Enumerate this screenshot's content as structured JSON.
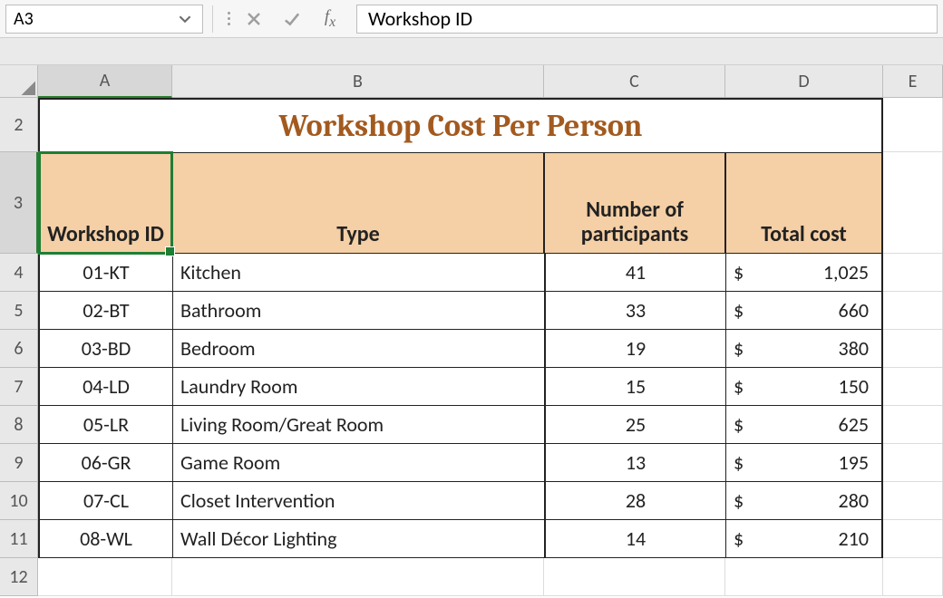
{
  "formulaBar": {
    "nameBox": "A3",
    "formula": "Workshop ID"
  },
  "columns": [
    "A",
    "B",
    "C",
    "D",
    "E"
  ],
  "activeColumn": "A",
  "activeRow": 3,
  "titleRow": 2,
  "title": "Workshop Cost Per Person",
  "headers": {
    "id": "Workshop ID",
    "type": "Type",
    "participants": "Number of participants",
    "cost": "Total cost"
  },
  "currencySymbol": "$",
  "rows": [
    {
      "n": 4,
      "id": "01-KT",
      "type": "Kitchen",
      "participants": 41,
      "cost": "1,025"
    },
    {
      "n": 5,
      "id": "02-BT",
      "type": "Bathroom",
      "participants": 33,
      "cost": "660"
    },
    {
      "n": 6,
      "id": "03-BD",
      "type": "Bedroom",
      "participants": 19,
      "cost": "380"
    },
    {
      "n": 7,
      "id": "04-LD",
      "type": "Laundry Room",
      "participants": 15,
      "cost": "150"
    },
    {
      "n": 8,
      "id": "05-LR",
      "type": "Living Room/Great Room",
      "participants": 25,
      "cost": "625"
    },
    {
      "n": 9,
      "id": "06-GR",
      "type": "Game Room",
      "participants": 13,
      "cost": "195"
    },
    {
      "n": 10,
      "id": "07-CL",
      "type": "Closet Intervention",
      "participants": 28,
      "cost": "280"
    },
    {
      "n": 11,
      "id": "08-WL",
      "type": "Wall Décor Lighting",
      "participants": 14,
      "cost": "210"
    }
  ],
  "emptyRow": 12,
  "chart_data": {
    "type": "table",
    "title": "Workshop Cost Per Person",
    "columns": [
      "Workshop ID",
      "Type",
      "Number of participants",
      "Total cost"
    ],
    "rows": [
      [
        "01-KT",
        "Kitchen",
        41,
        1025
      ],
      [
        "02-BT",
        "Bathroom",
        33,
        660
      ],
      [
        "03-BD",
        "Bedroom",
        19,
        380
      ],
      [
        "04-LD",
        "Laundry Room",
        15,
        150
      ],
      [
        "05-LR",
        "Living Room/Great Room",
        25,
        625
      ],
      [
        "06-GR",
        "Game Room",
        13,
        195
      ],
      [
        "07-CL",
        "Closet Intervention",
        28,
        280
      ],
      [
        "08-WL",
        "Wall Décor Lighting",
        14,
        210
      ]
    ]
  }
}
